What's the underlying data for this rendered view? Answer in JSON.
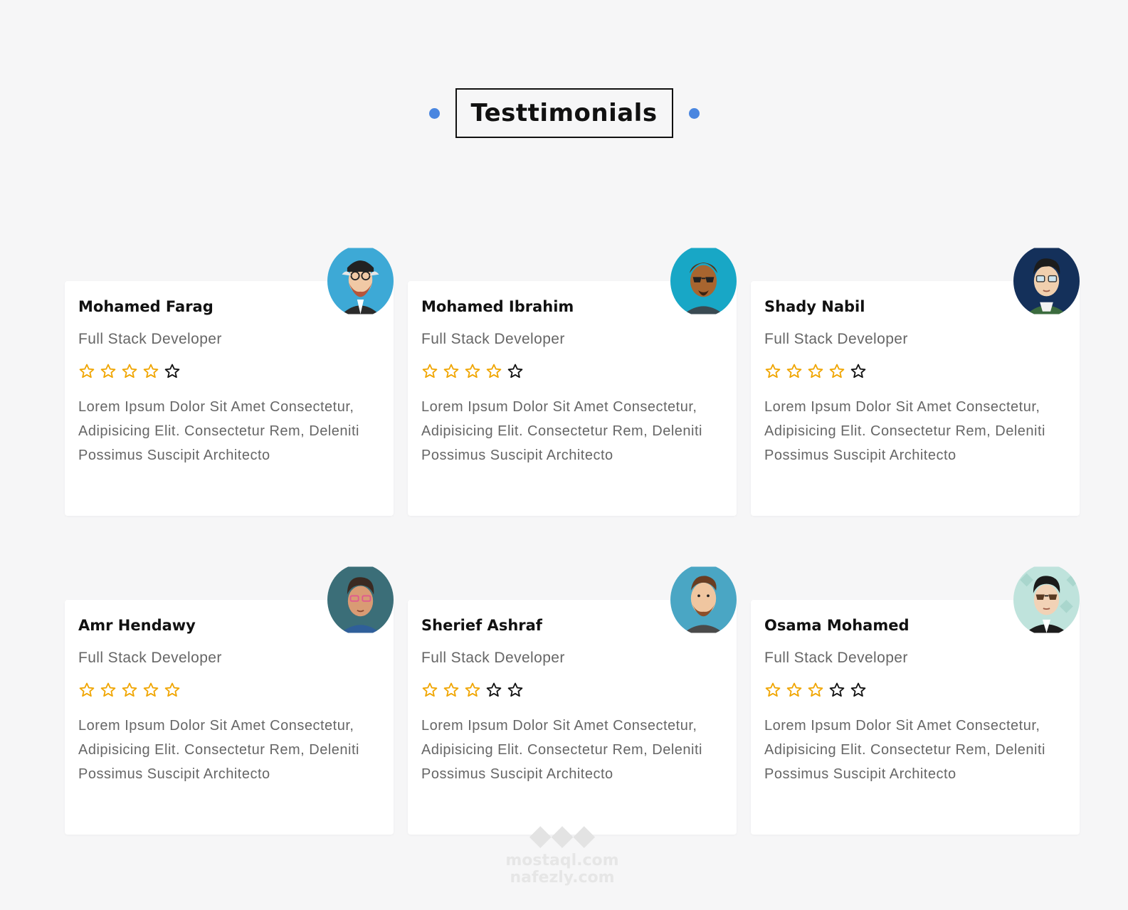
{
  "header": {
    "title": "Testtimonials"
  },
  "colors": {
    "accent_dot": "#4a86e0",
    "star_filled": "#f0a500",
    "star_empty": "#111111"
  },
  "testimonials": [
    {
      "name": "Mohamed Farag",
      "role": "Full Stack Developer",
      "rating": 4,
      "avatar": "hipster-glasses-beard-avatar",
      "text": "Lorem Ipsum Dolor Sit Amet Consectetur, Adipisicing Elit. Consectetur Rem, Deleniti Possimus Suscipit Architecto"
    },
    {
      "name": "Mohamed Ibrahim",
      "role": "Full Stack Developer",
      "rating": 4,
      "avatar": "sunglasses-man-avatar",
      "text": "Lorem Ipsum Dolor Sit Amet Consectetur, Adipisicing Elit. Consectetur Rem, Deleniti Possimus Suscipit Architecto"
    },
    {
      "name": "Shady Nabil",
      "role": "Full Stack Developer",
      "rating": 4,
      "avatar": "glasses-man-avatar",
      "text": "Lorem Ipsum Dolor Sit Amet Consectetur, Adipisicing Elit. Consectetur Rem, Deleniti Possimus Suscipit Architecto"
    },
    {
      "name": "Amr Hendawy",
      "role": "Full Stack Developer",
      "rating": 5,
      "avatar": "pink-glasses-man-avatar",
      "text": "Lorem Ipsum Dolor Sit Amet Consectetur, Adipisicing Elit. Consectetur Rem, Deleniti Possimus Suscipit Architecto"
    },
    {
      "name": "Sherief Ashraf",
      "role": "Full Stack Developer",
      "rating": 3,
      "avatar": "bearded-man-avatar",
      "text": "Lorem Ipsum Dolor Sit Amet Consectetur, Adipisicing Elit. Consectetur Rem, Deleniti Possimus Suscipit Architecto"
    },
    {
      "name": "Osama Mohamed",
      "role": "Full Stack Developer",
      "rating": 3,
      "avatar": "sunglasses-suit-man-avatar",
      "text": "Lorem Ipsum Dolor Sit Amet Consectetur, Adipisicing Elit. Consectetur Rem, Deleniti Possimus Suscipit Architecto"
    }
  ],
  "watermark": {
    "line1": "mostaql.com",
    "line2": "nafezly.com"
  }
}
